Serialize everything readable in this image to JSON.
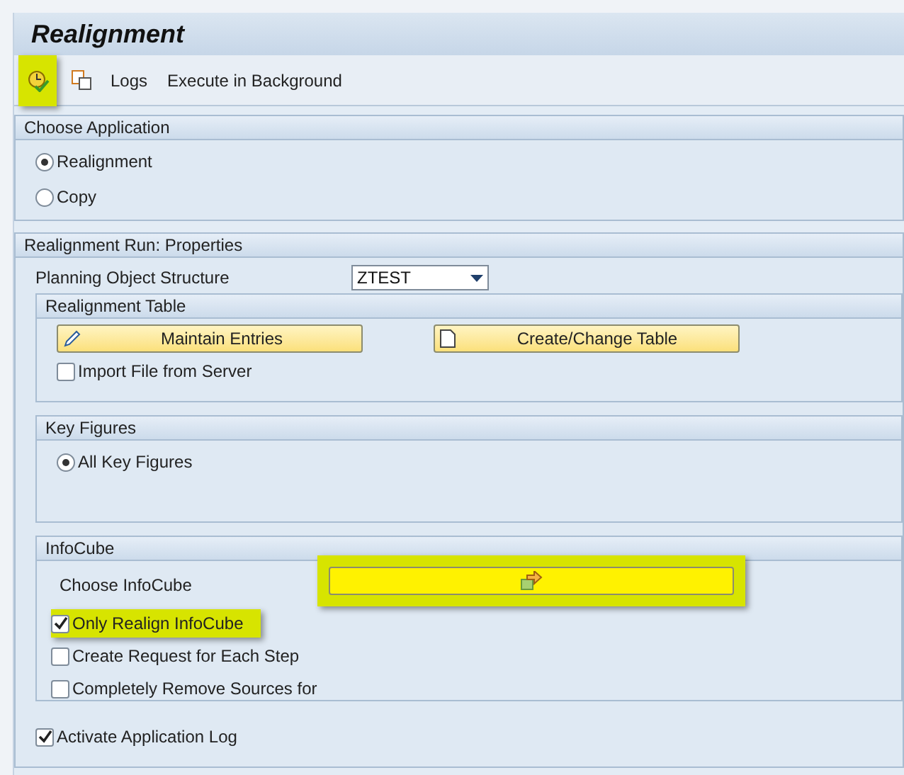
{
  "window": {
    "title": "Realignment"
  },
  "toolbar": [
    {
      "kind": "execute-icon",
      "highlighted": true
    },
    {
      "kind": "copy-icon",
      "highlighted": false
    },
    {
      "kind": "text",
      "label": "Logs",
      "highlighted": false
    },
    {
      "kind": "text",
      "label": "Execute in Background",
      "highlighted": false
    }
  ],
  "choose_application": {
    "title": "Choose Application",
    "options": [
      {
        "label": "Realignment",
        "selected": true
      },
      {
        "label": "Copy",
        "selected": false
      }
    ]
  },
  "properties": {
    "title": "Realignment Run: Properties",
    "planning_object_structure": {
      "label": "Planning Object Structure",
      "value": "ZTEST"
    },
    "realignment_table": {
      "title": "Realignment Table",
      "buttons": [
        {
          "kind": "pencil",
          "label": "Maintain Entries"
        },
        {
          "kind": "document",
          "label": "Create/Change Table"
        }
      ],
      "import_file": {
        "label": "Import File from Server",
        "checked": false
      }
    },
    "key_figures": {
      "title": "Key Figures",
      "options": [
        {
          "label": "All Key Figures",
          "selected": true
        }
      ]
    },
    "infocube": {
      "title": "InfoCube",
      "field_label": "Choose InfoCube",
      "field_highlighted": true,
      "checkboxes": [
        {
          "label": "Only Realign InfoCube",
          "checked": true,
          "highlighted": true
        },
        {
          "label": "Create Request for Each Step",
          "checked": false,
          "highlighted": false
        },
        {
          "label": "Completely Remove Sources for",
          "checked": false,
          "highlighted": false
        }
      ]
    },
    "activate_log": {
      "label": "Activate Application Log",
      "checked": true
    }
  }
}
